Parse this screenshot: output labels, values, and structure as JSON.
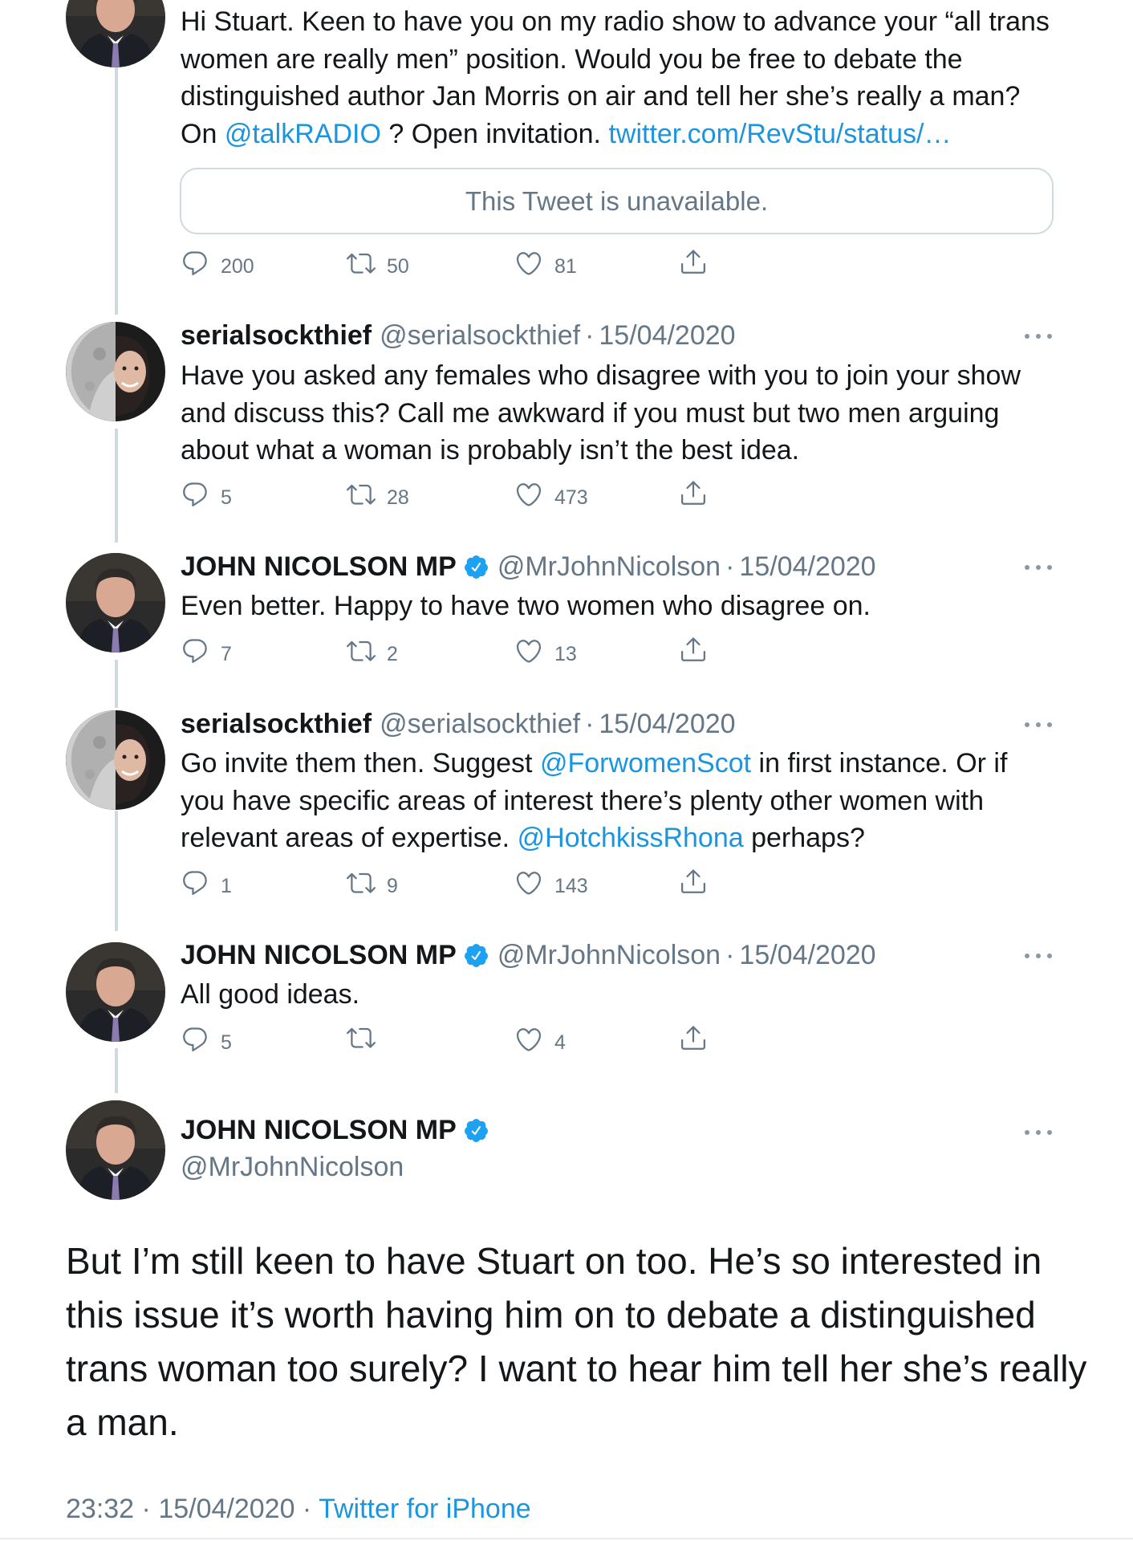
{
  "colors": {
    "link": "#1b95e0",
    "secondary_text": "#657786",
    "verified_badge": "#1da1f2",
    "thread_line": "#cfd9de"
  },
  "tweet1": {
    "text_lines": [
      [
        "Hi Stuart. Keen to have you on my radio show to advance your “all trans"
      ],
      [
        "women are really men” position. Would you be free to debate the"
      ],
      [
        "distinguished author Jan Morris on air and tell her she’s really a man?"
      ],
      [
        "On ",
        "@talkRADIO",
        " ? Open invitation. ",
        "twitter.com/RevStu/status/…"
      ]
    ],
    "quote": "This Tweet is unavailable.",
    "replies": "200",
    "retweets": "50",
    "likes": "81"
  },
  "tweet2": {
    "name": "serialsockthief",
    "handle": "@serialsockthief",
    "separator": "·",
    "date": "15/04/2020",
    "text_lines": [
      [
        "Have you asked any females who disagree with you to join your show"
      ],
      [
        "and discuss this? Call me awkward if you must but two men arguing"
      ],
      [
        "about what a woman is probably isn’t the best idea."
      ]
    ],
    "replies": "5",
    "retweets": "28",
    "likes": "473"
  },
  "tweet3": {
    "name": "JOHN NICOLSON MP",
    "handle": "@MrJohnNicolson",
    "separator": "·",
    "date": "15/04/2020",
    "text_lines": [
      [
        "Even better. Happy to have two women who disagree on."
      ]
    ],
    "replies": "7",
    "retweets": "2",
    "likes": "13"
  },
  "tweet4": {
    "name": "serialsockthief",
    "handle": "@serialsockthief",
    "separator": "·",
    "date": "15/04/2020",
    "text_lines": [
      [
        "Go invite them then. Suggest ",
        "@ForwomenScot",
        " in first instance. Or if"
      ],
      [
        "you have specific areas of interest there’s plenty other women with"
      ],
      [
        "relevant areas of expertise. ",
        "@HotchkissRhona",
        " perhaps?"
      ]
    ],
    "replies": "1",
    "retweets": "9",
    "likes": "143"
  },
  "tweet5": {
    "name": "JOHN NICOLSON MP",
    "handle": "@MrJohnNicolson",
    "separator": "·",
    "date": "15/04/2020",
    "text_lines": [
      [
        "All good ideas."
      ]
    ],
    "replies": "5",
    "retweets": "",
    "likes": "4"
  },
  "main_tweet": {
    "name": "JOHN NICOLSON MP",
    "handle": "@MrJohnNicolson",
    "text_lines": [
      "But I’m still keen to have Stuart on too. He’s so interested in",
      "this issue it’s worth having him on to debate a distinguished",
      "trans woman too surely? I want to hear him tell her she’s really",
      "a man."
    ],
    "time": "23:32",
    "separator": " · ",
    "date": "15/04/2020",
    "separator2": " · ",
    "source": "Twitter for iPhone"
  },
  "icons": {
    "reply": "reply-icon",
    "retweet": "retweet-icon",
    "like": "heart-icon",
    "share": "share-icon",
    "verified": "verified-badge-icon",
    "more": "more-dots-icon"
  }
}
